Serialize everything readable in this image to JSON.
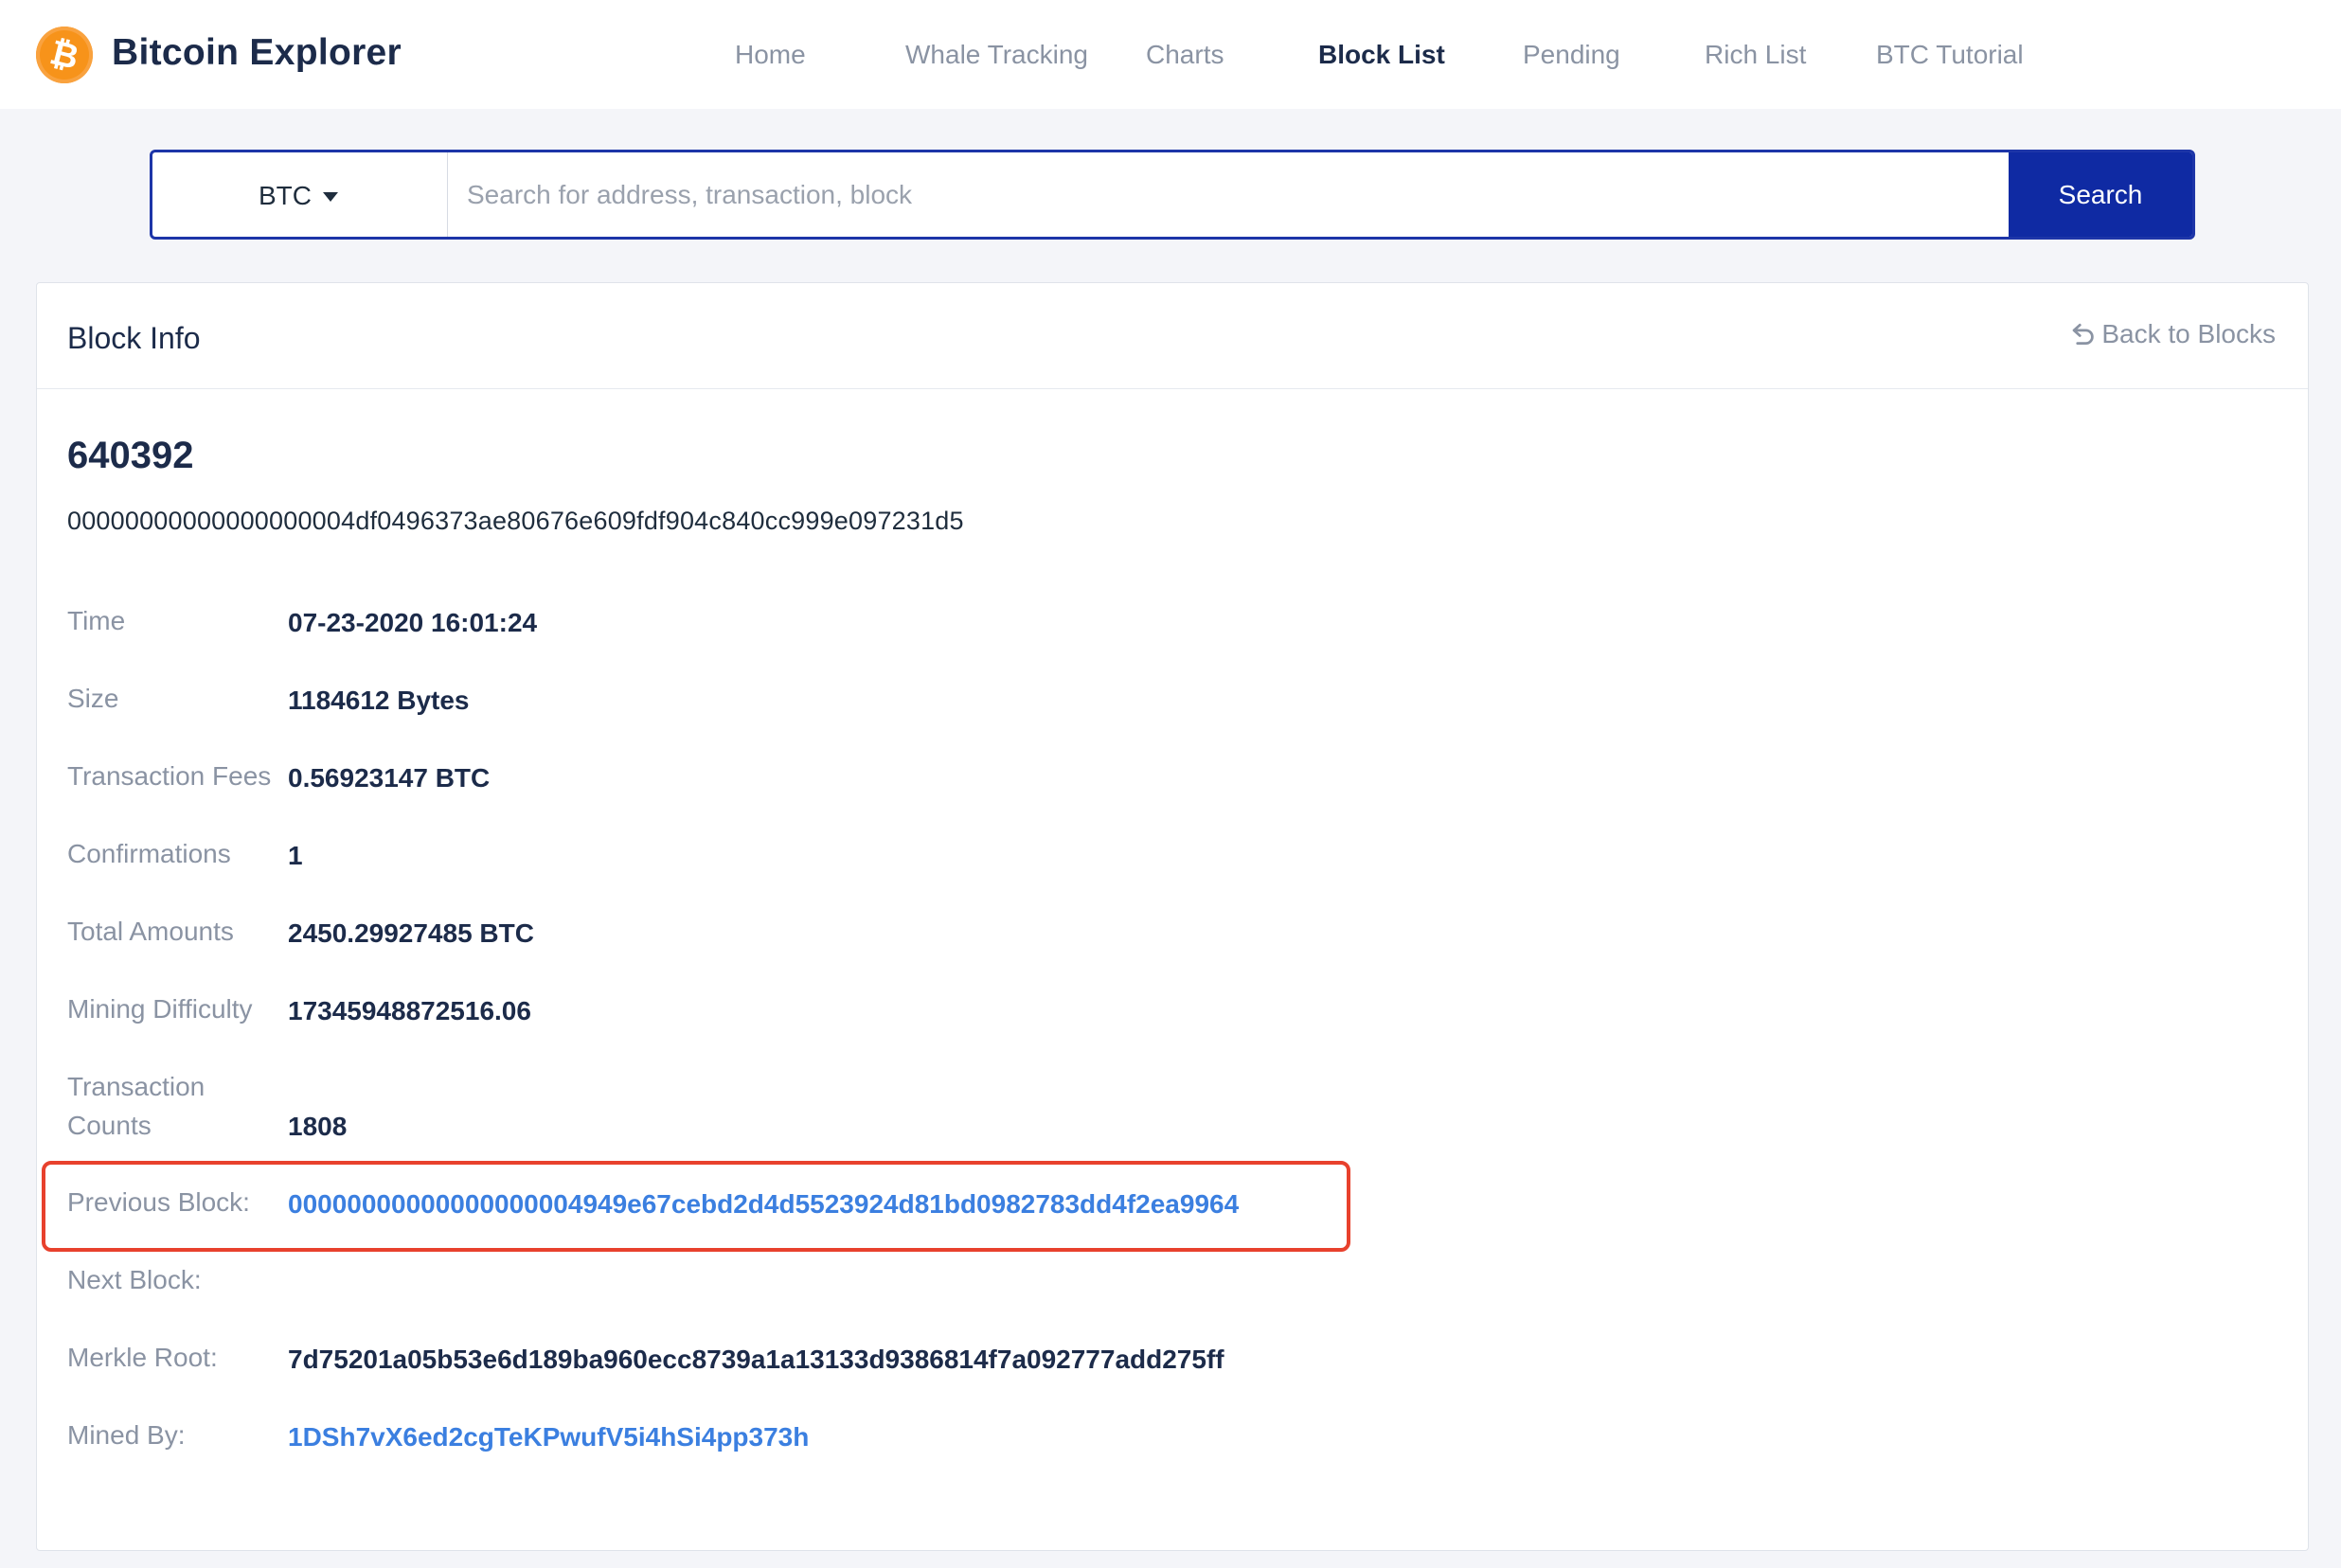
{
  "header": {
    "brand": "Bitcoin Explorer",
    "logo_symbol": "₿",
    "nav": [
      {
        "label": "Home",
        "active": false
      },
      {
        "label": "Whale Tracking",
        "active": false
      },
      {
        "label": "Charts",
        "active": false
      },
      {
        "label": "Block List",
        "active": true
      },
      {
        "label": "Pending",
        "active": false
      },
      {
        "label": "Rich List",
        "active": false
      },
      {
        "label": "BTC Tutorial",
        "active": false
      }
    ]
  },
  "search": {
    "coin": "BTC",
    "placeholder": "Search for address, transaction, block",
    "value": "",
    "button_label": "Search"
  },
  "card": {
    "title": "Block Info",
    "back_label": "Back to Blocks"
  },
  "block": {
    "height": "640392",
    "hash": "00000000000000000004df0496373ae80676e609fdf904c840cc999e097231d5",
    "fields": {
      "time": {
        "label": "Time",
        "value": "07-23-2020 16:01:24"
      },
      "size": {
        "label": "Size",
        "value": "1184612 Bytes"
      },
      "fees": {
        "label": "Transaction Fees",
        "value": "0.56923147 BTC"
      },
      "confirmations": {
        "label": "Confirmations",
        "value": "1"
      },
      "total": {
        "label": "Total Amounts",
        "value": "2450.29927485 BTC"
      },
      "difficulty": {
        "label": "Mining Difficulty",
        "value": "17345948872516.06"
      },
      "tx_count": {
        "label": "Transaction Counts",
        "value": "1808"
      },
      "prev_block": {
        "label": "Previous Block:",
        "value": "00000000000000000004949e67cebd2d4d5523924d81bd0982783dd4f2ea9964"
      },
      "next_block": {
        "label": "Next Block:",
        "value": ""
      },
      "merkle_root": {
        "label": "Merkle Root:",
        "value": "7d75201a05b53e6d189ba960ecc8739a1a13133d9386814f7a092777add275ff"
      },
      "mined_by": {
        "label": "Mined By:",
        "value": "1DSh7vX6ed2cgTeKPwufV5i4hSi4pp373h"
      }
    }
  },
  "colors": {
    "brand_orange": "#f7931a",
    "primary_blue": "#0f2aa3",
    "link_blue": "#3b7fe0",
    "highlight_red": "#e8412d"
  }
}
